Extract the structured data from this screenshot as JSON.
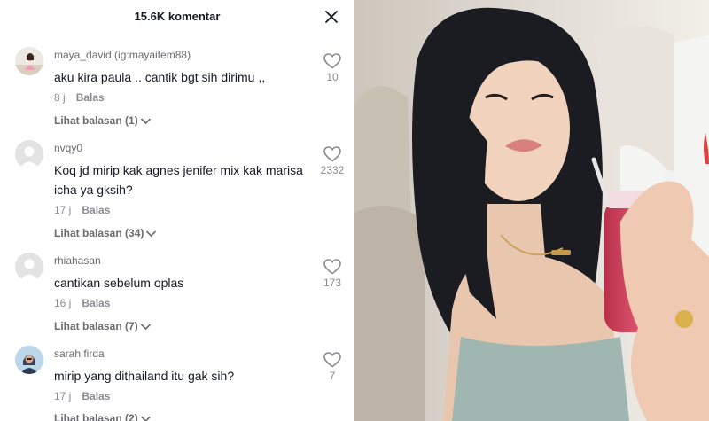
{
  "header": {
    "title": "15.6K komentar"
  },
  "comments": [
    {
      "username": "maya_david (ig:mayaitem88)",
      "text": "aku kira paula .. cantik bgt sih dirimu ,,",
      "time": "8 j",
      "reply_label": "Balas",
      "replies_label": "Lihat balasan (1)",
      "likes": "10"
    },
    {
      "username": "nvqy0",
      "text": "Koq jd mirip kak agnes jenifer mix kak marisa icha ya gksih?",
      "time": "17 j",
      "reply_label": "Balas",
      "replies_label": "Lihat balasan (34)",
      "likes": "2332"
    },
    {
      "username": "rhiahasan",
      "text": "cantikan sebelum oplas",
      "time": "16 j",
      "reply_label": "Balas",
      "replies_label": "Lihat balasan (7)",
      "likes": "173"
    },
    {
      "username": "sarah firda",
      "text": "mirip yang dithailand itu gak sih?",
      "time": "17 j",
      "reply_label": "Balas",
      "replies_label": "Lihat balasan (2)",
      "likes": "7"
    }
  ],
  "icons": {
    "close": "close-icon",
    "like": "heart-outline-icon",
    "expand": "chevron-down-icon"
  },
  "colors": {
    "text": "#161823",
    "muted": "#8a8b91",
    "avatar_placeholder": "#e3e3e4"
  }
}
